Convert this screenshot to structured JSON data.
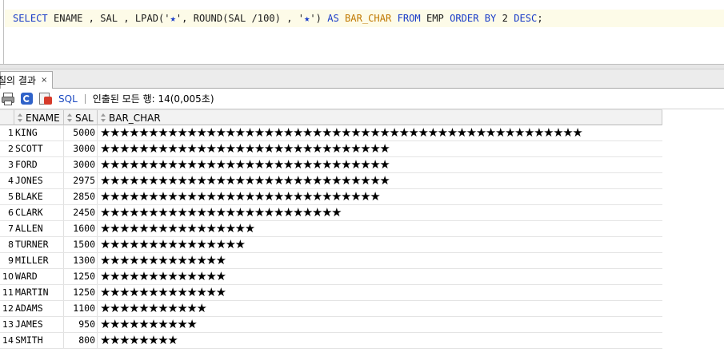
{
  "editor": {
    "sql_tokens": [
      {
        "t": "SELECT",
        "c": "kw"
      },
      {
        "t": " ENAME , SAL , LPAD('",
        "c": "id"
      },
      {
        "t": "★",
        "c": "star"
      },
      {
        "t": "', ROUND(SAL /100) , '",
        "c": "id"
      },
      {
        "t": "★",
        "c": "star"
      },
      {
        "t": "') ",
        "c": "id"
      },
      {
        "t": "AS",
        "c": "kw"
      },
      {
        "t": " ",
        "c": "id"
      },
      {
        "t": "BAR_CHAR",
        "c": "col-kw"
      },
      {
        "t": " ",
        "c": "id"
      },
      {
        "t": "FROM",
        "c": "kw"
      },
      {
        "t": " EMP ",
        "c": "id"
      },
      {
        "t": "ORDER BY",
        "c": "kw"
      },
      {
        "t": " 2 ",
        "c": "id"
      },
      {
        "t": "DESC",
        "c": "kw"
      },
      {
        "t": ";",
        "c": "id"
      }
    ]
  },
  "results_tab": {
    "label": "질의 결과",
    "close": "×"
  },
  "toolbar": {
    "sql_label": "SQL",
    "separator": "|",
    "status": "인출된 모든 행: 14(0,005초)"
  },
  "grid": {
    "columns": [
      "ENAME",
      "SAL",
      "BAR_CHAR"
    ],
    "rows": [
      {
        "n": "1",
        "ename": "KING",
        "sal": "5000",
        "bar": "★★★★★★★★★★★★★★★★★★★★★★★★★★★★★★★★★★★★★★★★★★★★★★★★★★"
      },
      {
        "n": "2",
        "ename": "SCOTT",
        "sal": "3000",
        "bar": "★★★★★★★★★★★★★★★★★★★★★★★★★★★★★★"
      },
      {
        "n": "3",
        "ename": "FORD",
        "sal": "3000",
        "bar": "★★★★★★★★★★★★★★★★★★★★★★★★★★★★★★"
      },
      {
        "n": "4",
        "ename": "JONES",
        "sal": "2975",
        "bar": "★★★★★★★★★★★★★★★★★★★★★★★★★★★★★★"
      },
      {
        "n": "5",
        "ename": "BLAKE",
        "sal": "2850",
        "bar": "★★★★★★★★★★★★★★★★★★★★★★★★★★★★★"
      },
      {
        "n": "6",
        "ename": "CLARK",
        "sal": "2450",
        "bar": "★★★★★★★★★★★★★★★★★★★★★★★★★"
      },
      {
        "n": "7",
        "ename": "ALLEN",
        "sal": "1600",
        "bar": "★★★★★★★★★★★★★★★★"
      },
      {
        "n": "8",
        "ename": "TURNER",
        "sal": "1500",
        "bar": "★★★★★★★★★★★★★★★"
      },
      {
        "n": "9",
        "ename": "MILLER",
        "sal": "1300",
        "bar": "★★★★★★★★★★★★★"
      },
      {
        "n": "10",
        "ename": "WARD",
        "sal": "1250",
        "bar": "★★★★★★★★★★★★★"
      },
      {
        "n": "11",
        "ename": "MARTIN",
        "sal": "1250",
        "bar": "★★★★★★★★★★★★★"
      },
      {
        "n": "12",
        "ename": "ADAMS",
        "sal": "1100",
        "bar": "★★★★★★★★★★★"
      },
      {
        "n": "13",
        "ename": "JAMES",
        "sal": "950",
        "bar": "★★★★★★★★★★"
      },
      {
        "n": "14",
        "ename": "SMITH",
        "sal": "800",
        "bar": "★★★★★★★★"
      }
    ]
  },
  "colors": {
    "keyword": "#1a3cc8",
    "column_alias": "#c07800",
    "sql_link": "#1a48c0"
  }
}
